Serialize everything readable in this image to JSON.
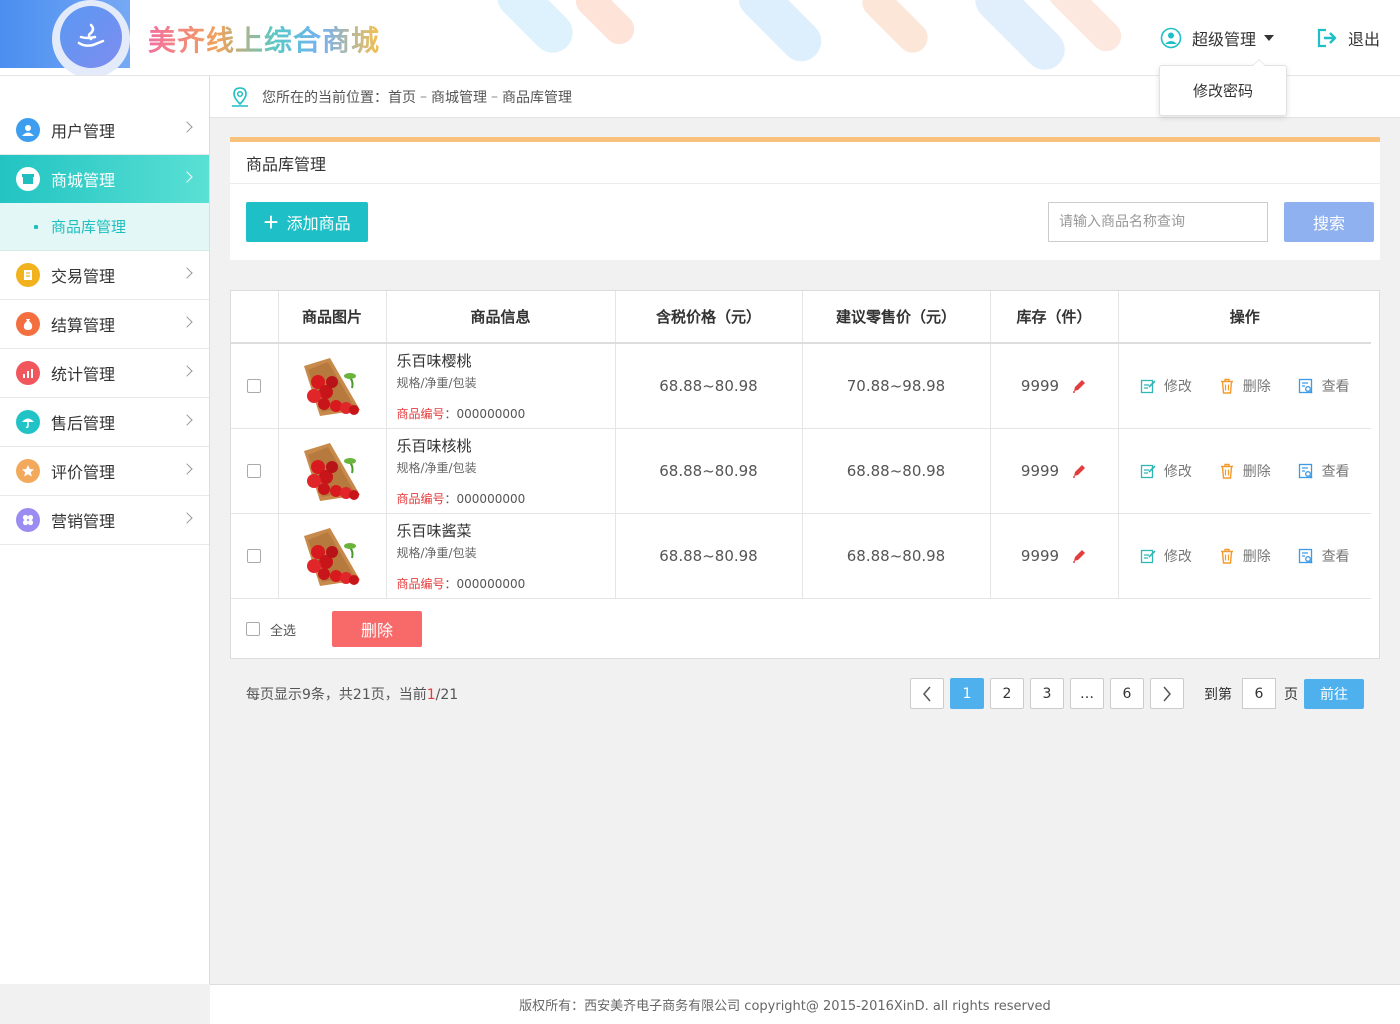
{
  "header": {
    "brand": "美齐线上综合商城",
    "user_name": "超级管理",
    "logout_label": "退出",
    "dropdown_item": "修改密码"
  },
  "sidebar": {
    "items": [
      {
        "label": "用户管理",
        "icon": "user-icon",
        "color": "#3d9ef0"
      },
      {
        "label": "商城管理",
        "icon": "shop-icon",
        "color": "#ffffff"
      },
      {
        "label": "交易管理",
        "icon": "trade-icon",
        "color": "#f2b21e"
      },
      {
        "label": "结算管理",
        "icon": "money-bag-icon",
        "color": "#f36f3f"
      },
      {
        "label": "统计管理",
        "icon": "stats-icon",
        "color": "#f0565b"
      },
      {
        "label": "售后管理",
        "icon": "umbrella-icon",
        "color": "#22c3c6"
      },
      {
        "label": "评价管理",
        "icon": "star-icon",
        "color": "#f3a95c"
      },
      {
        "label": "营销管理",
        "icon": "marketing-icon",
        "color": "#9a8cf0"
      }
    ],
    "sub_active": "商品库管理"
  },
  "breadcrumb": {
    "prefix": "您所在的当前位置：",
    "items": [
      "首页",
      "商城管理",
      "商品库管理"
    ],
    "sep": "–"
  },
  "panel": {
    "title": "商品库管理",
    "add_button": "添加商品",
    "search_placeholder": "请输入商品名称查询",
    "search_button": "搜索"
  },
  "table": {
    "headers": [
      "商品图片",
      "商品信息",
      "含税价格（元）",
      "建议零售价（元）",
      "库存（件）",
      "操作"
    ],
    "rows": [
      {
        "name": "乐百味樱桃",
        "spec": "规格/净重/包装",
        "code_label": "商品编号",
        "code": "000000000",
        "price": "68.88~80.98",
        "retail": "70.88~98.98",
        "stock": "9999"
      },
      {
        "name": "乐百味核桃",
        "spec": "规格/净重/包装",
        "code_label": "商品编号",
        "code": "000000000",
        "price": "68.88~80.98",
        "retail": "68.88~80.98",
        "stock": "9999"
      },
      {
        "name": "乐百味酱菜",
        "spec": "规格/净重/包装",
        "code_label": "商品编号",
        "code": "000000000",
        "price": "68.88~80.98",
        "retail": "68.88~80.98",
        "stock": "9999"
      }
    ],
    "op_edit": "修改",
    "op_delete": "删除",
    "op_view": "查看",
    "select_all": "全选",
    "delete_button": "删除"
  },
  "pagination": {
    "info_prefix": "每页显示9条，共21页，当前",
    "current": "1",
    "info_suffix": "/21",
    "pages": [
      "1",
      "2",
      "3",
      "…",
      "6"
    ],
    "goto_label": "到第",
    "goto_value": "6",
    "page_label": "页",
    "go_button": "前往"
  },
  "footer": {
    "text": "版权所有：西安美齐电子商务有限公司 copyright@ 2015-2016XinD. all rights reserved"
  },
  "colors": {
    "accent": "#1ebfc6",
    "header_accent": "#f9c27c",
    "danger": "#f86a6a",
    "pager_active": "#4eb1ee"
  }
}
